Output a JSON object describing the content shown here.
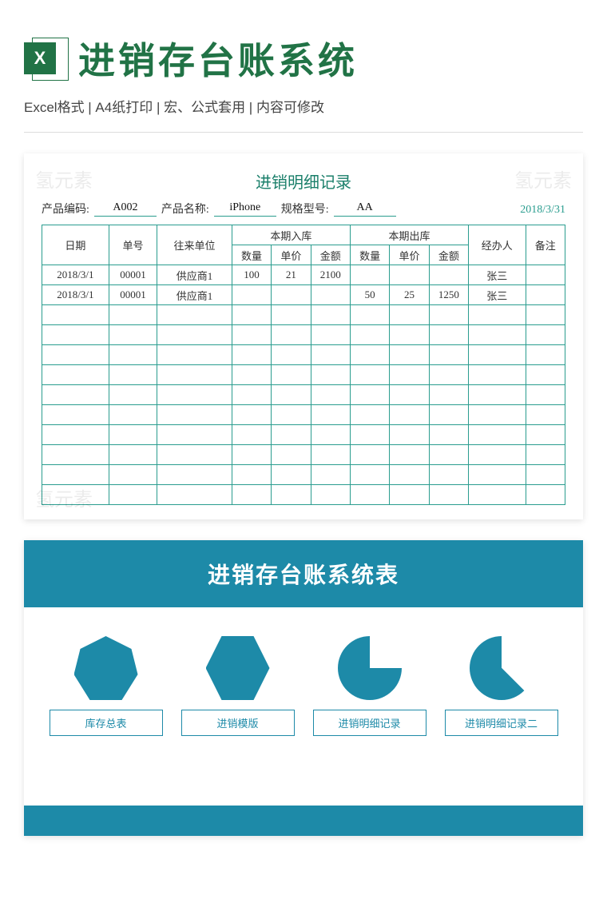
{
  "header": {
    "icon_text": "X",
    "title": "进销存台账系统",
    "subtitle": "Excel格式 |  A4纸打印 | 宏、公式套用 | 内容可修改"
  },
  "sheet": {
    "title": "进销明细记录",
    "date": "2018/3/31",
    "meta": {
      "code_label": "产品编码:",
      "code": "A002",
      "name_label": "产品名称:",
      "name": "iPhone",
      "spec_label": "规格型号:",
      "spec": "AA"
    },
    "cols": {
      "date": "日期",
      "order": "单号",
      "partner": "往来单位",
      "in_group": "本期入库",
      "out_group": "本期出库",
      "qty": "数量",
      "price": "单价",
      "amount": "金额",
      "handler": "经办人",
      "remark": "备注"
    },
    "rows": [
      {
        "date": "2018/3/1",
        "order": "00001",
        "partner": "供应商1",
        "in_qty": "100",
        "in_price": "21",
        "in_amt": "2100",
        "out_qty": "",
        "out_price": "",
        "out_amt": "",
        "handler": "张三",
        "remark": ""
      },
      {
        "date": "2018/3/1",
        "order": "00001",
        "partner": "供应商1",
        "in_qty": "",
        "in_price": "",
        "in_amt": "",
        "out_qty": "50",
        "out_price": "25",
        "out_amt": "1250",
        "handler": "张三",
        "remark": ""
      }
    ]
  },
  "chart_card": {
    "title": "进销存台账系统表",
    "buttons": [
      "库存总表",
      "进销模版",
      "进销明细记录",
      "进销明细记录二"
    ]
  },
  "chart_data": {
    "type": "table",
    "title": "进销明细记录",
    "columns": [
      "日期",
      "单号",
      "往来单位",
      "本期入库数量",
      "本期入库单价",
      "本期入库金额",
      "本期出库数量",
      "本期出库单价",
      "本期出库金额",
      "经办人",
      "备注"
    ],
    "rows": [
      [
        "2018/3/1",
        "00001",
        "供应商1",
        100,
        21,
        2100,
        null,
        null,
        null,
        "张三",
        ""
      ],
      [
        "2018/3/1",
        "00001",
        "供应商1",
        null,
        null,
        null,
        50,
        25,
        1250,
        "张三",
        ""
      ]
    ]
  },
  "watermark": "氢元素"
}
